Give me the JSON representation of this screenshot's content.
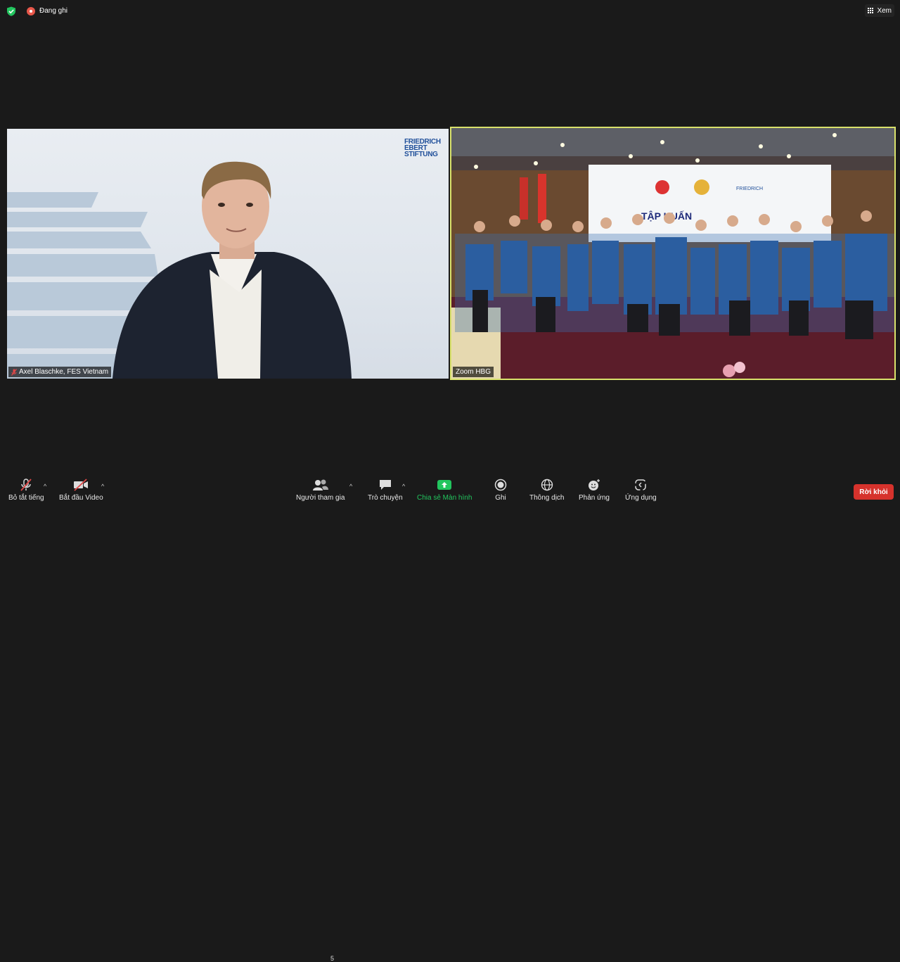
{
  "topbar": {
    "recording_label": "Đang ghi",
    "view_label": "Xem"
  },
  "videos": [
    {
      "name": "Axel Blaschke, FES Vietnam",
      "muted": true,
      "logo_text": [
        "FRIEDRICH",
        "EBERT",
        "STIFTUNG"
      ]
    },
    {
      "name": "Zoom HBG",
      "muted": false,
      "active_speaker": true,
      "banner_text": "TẬP HUẤN"
    }
  ],
  "toolbar": {
    "mute_label": "Bỏ tắt tiếng",
    "video_label": "Bắt đầu Video",
    "participants_label": "Người tham gia",
    "participants_count": "5",
    "chat_label": "Trò chuyện",
    "share_label": "Chia sẻ Màn hình",
    "record_label": "Ghi",
    "interpret_label": "Thông dịch",
    "reactions_label": "Phản ứng",
    "apps_label": "Ứng dụng",
    "leave_label": "Rời khỏi"
  },
  "colors": {
    "background": "#1a1a1a",
    "share_green": "#22c55e",
    "leave_red": "#d6322c",
    "active_border": "#d9e26b"
  }
}
